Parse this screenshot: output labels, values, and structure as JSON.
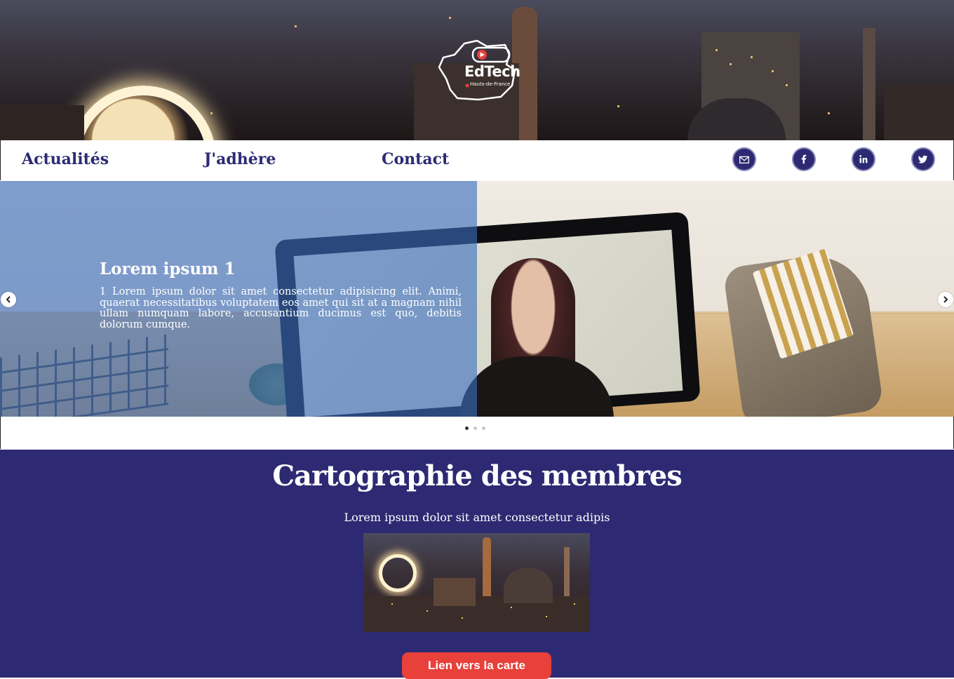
{
  "brand": {
    "name": "EdTech",
    "region": "Hauts-de-France"
  },
  "nav": {
    "items": [
      {
        "label": "Actualités"
      },
      {
        "label": "J'adhère"
      },
      {
        "label": "Contact"
      }
    ],
    "social": [
      "mail-icon",
      "facebook-icon",
      "linkedin-icon",
      "twitter-icon"
    ]
  },
  "carousel": {
    "title": "Lorem ipsum 1",
    "body": "1 Lorem ipsum dolor sit amet consectetur adipisicing elit. Animi, quaerat necessitatibus voluptatem eos amet qui sit at a magnam nihil ullam numquam labore, accusantium ducimus est quo, debitis dolorum cumque.",
    "slide_count": 3,
    "active_index": 0
  },
  "members": {
    "title": "Cartographie des membres",
    "subtitle": "Lorem ipsum dolor sit amet consectetur adipis",
    "cta_label": "Lien vers la carte"
  },
  "colors": {
    "primary": "#2d2a73",
    "accent": "#e8403a",
    "overlay": "#3a6ebe"
  }
}
